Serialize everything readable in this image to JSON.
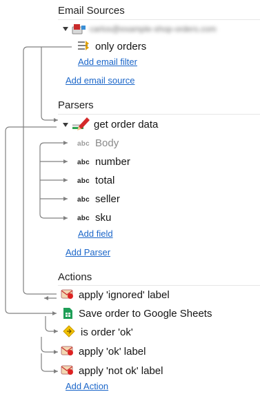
{
  "email_sources": {
    "title": "Email Sources",
    "account": "carlos@example-shop-orders.com",
    "filter_label": "only orders",
    "add_filter": "Add email filter",
    "add_source": "Add email source"
  },
  "parsers": {
    "title": "Parsers",
    "parser_name": "get order data",
    "field_type": "abc",
    "fields": [
      "Body",
      "number",
      "total",
      "seller",
      "sku"
    ],
    "add_field": "Add field",
    "add_parser": "Add Parser"
  },
  "actions": {
    "title": "Actions",
    "items": [
      "apply 'ignored' label",
      "Save order to Google Sheets",
      "is order 'ok'",
      "apply 'ok' label",
      "apply 'not ok' label"
    ],
    "add_action": "Add Action"
  },
  "colors": {
    "link": "#1b66c9",
    "connector": "#7a7a7a",
    "sheets_green": "#1e9e57",
    "condition_yellow": "#f2c200"
  }
}
